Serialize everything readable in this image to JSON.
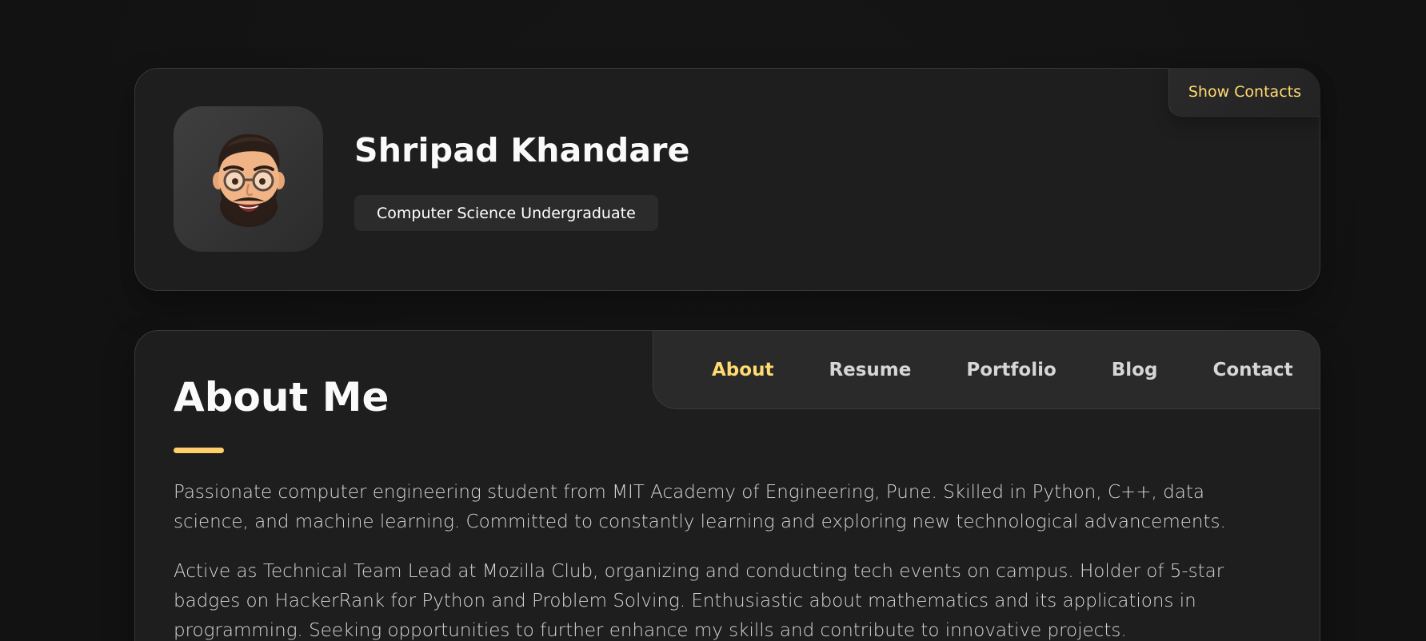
{
  "profile": {
    "name": "Shripad Khandare",
    "title": "Computer Science Undergraduate",
    "show_contacts_label": "Show Contacts",
    "avatar_icon": "memoji-avatar"
  },
  "navbar": {
    "items": [
      {
        "label": "About",
        "active": true
      },
      {
        "label": "Resume",
        "active": false
      },
      {
        "label": "Portfolio",
        "active": false
      },
      {
        "label": "Blog",
        "active": false
      },
      {
        "label": "Contact",
        "active": false
      }
    ]
  },
  "about": {
    "title": "About Me",
    "paragraphs": [
      "Passionate computer engineering student from MIT Academy of Engineering, Pune. Skilled in Python, C++, data science, and machine learning. Committed to constantly learning and exploring new technological advancements.",
      "Active as Technical Team Lead at Mozilla Club, organizing and conducting tech events on campus. Holder of 5-star badges on HackerRank for Python and Problem Solving. Enthusiastic about mathematics and its applications in programming. Seeking opportunities to further enhance my skills and contribute to innovative projects."
    ]
  },
  "colors": {
    "accent": "#ffdb70",
    "background": "#121212",
    "card": "#1e1e1f",
    "text": "#d6d6d6"
  }
}
